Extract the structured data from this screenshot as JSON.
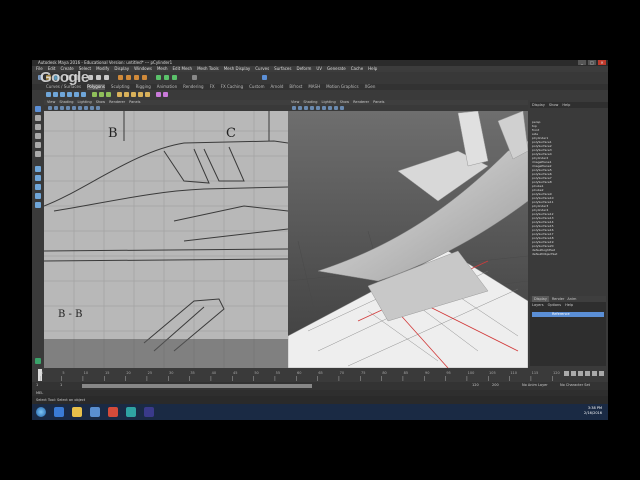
{
  "app": {
    "title": "Autodesk Maya 2016 - Educational Version: untitled*  ---  pCylinder1",
    "window_buttons": [
      "_",
      "□",
      "✕"
    ]
  },
  "overlay": {
    "logo_text": "Google"
  },
  "menubar": [
    "File",
    "Edit",
    "Create",
    "Select",
    "Modify",
    "Display",
    "Windows",
    "Mesh",
    "Edit Mesh",
    "Mesh Tools",
    "Mesh Display",
    "Curves",
    "Surfaces",
    "Deform",
    "UV",
    "Generate",
    "Cache",
    "Help"
  ],
  "shelf_tabs": [
    "Curves / Surfaces",
    "Polygons",
    "Sculpting",
    "Rigging",
    "Animation",
    "Rendering",
    "FX",
    "FX Caching",
    "Custom",
    "Arnold",
    "Bifrost",
    "MASH",
    "Motion Graphics",
    "XGen"
  ],
  "left_viewport": {
    "menu": [
      "View",
      "Shading",
      "Lighting",
      "Show",
      "Renderer",
      "Panels"
    ],
    "labels": [
      "B",
      "C",
      "B - B"
    ]
  },
  "right_viewport": {
    "menu": [
      "View",
      "Shading",
      "Lighting",
      "Show",
      "Renderer",
      "Panels"
    ]
  },
  "outliner": {
    "menu": [
      "Display",
      "Show",
      "Help"
    ],
    "items": [
      "persp",
      "top",
      "front",
      "side",
      "pCylinder1",
      "polySurface1",
      "polySurface2",
      "polySurface3",
      "polySurface4",
      "pCylinder2",
      "imagePlane1",
      "imagePlane2",
      "polySurface5",
      "polySurface6",
      "polySurface7",
      "polySurface8",
      "pCube1",
      "pCube2",
      "polySurface9",
      "polySurface10",
      "polySurface11",
      "pCylinder3",
      "pCylinder4",
      "polySurface12",
      "polySurface13",
      "polySurface14",
      "polySurface15",
      "polySurface16",
      "polySurface17",
      "polySurface18",
      "polySurface19",
      "polySurface20",
      "defaultLightSet",
      "defaultObjectSet"
    ]
  },
  "layer_editor": {
    "tabs": [
      "Display",
      "Render",
      "Anim"
    ],
    "menu": [
      "Layers",
      "Options",
      "Help"
    ],
    "layer_name": "Reference"
  },
  "timeline": {
    "ticks": [
      "1",
      "5",
      "10",
      "15",
      "20",
      "25",
      "30",
      "35",
      "40",
      "45",
      "50",
      "55",
      "60",
      "65",
      "70",
      "75",
      "80",
      "85",
      "90",
      "95",
      "100",
      "105",
      "110",
      "115",
      "120"
    ],
    "current_frame": "1"
  },
  "range": {
    "start": "1",
    "start_inner": "1",
    "end_inner": "120",
    "end": "200",
    "anim_layer": "No Anim Layer",
    "char_set": "No Character Set"
  },
  "cmdline": {
    "label": "MEL"
  },
  "helpline": {
    "text": "Select Tool: Select an object"
  },
  "taskbar": {
    "time": "3:38 PM",
    "date": "2/16/2016"
  },
  "colors": {
    "maya_dark": "#3a3a3a",
    "accent_blue": "#5b8fd6",
    "taskbar": "#1a2a44"
  }
}
